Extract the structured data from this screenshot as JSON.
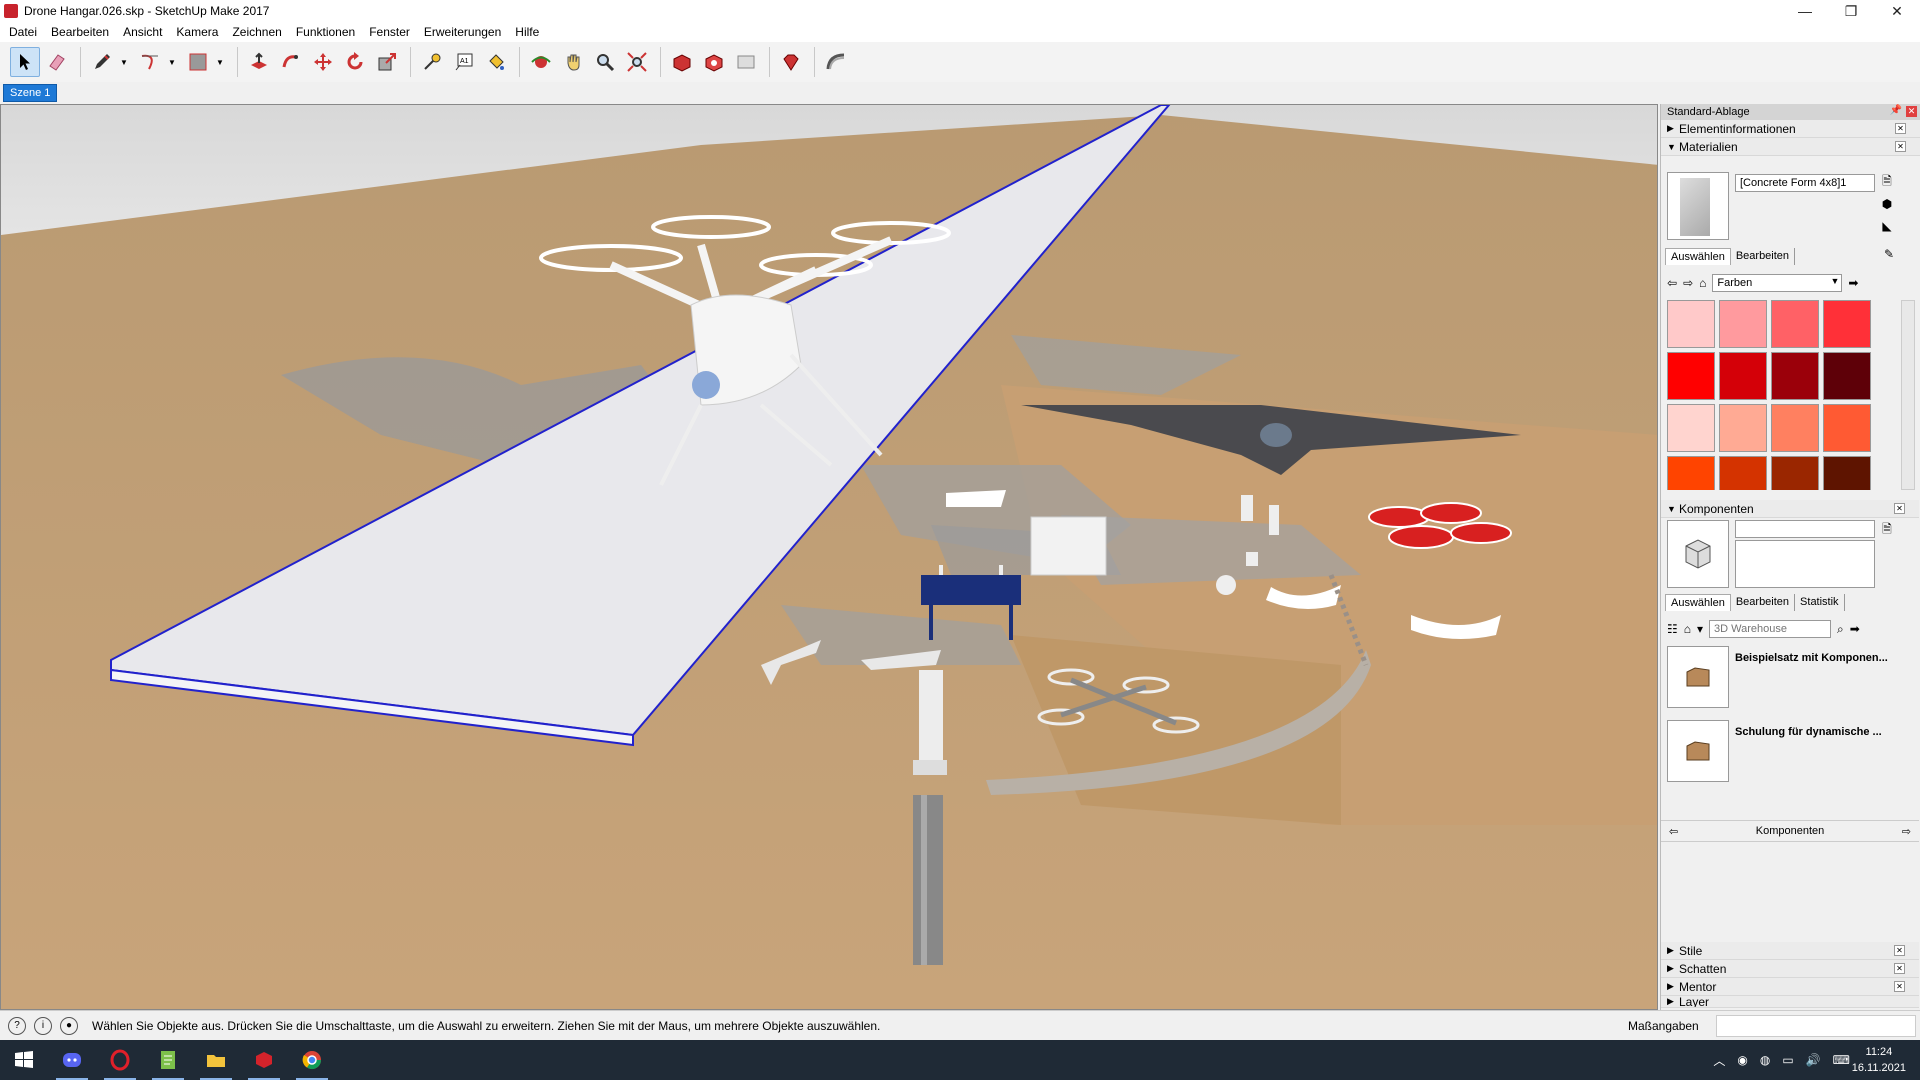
{
  "window": {
    "title": "Drone Hangar.026.skp - SketchUp Make 2017",
    "minimize": "—",
    "maximize": "❐",
    "close": "✕"
  },
  "menu": [
    "Datei",
    "Bearbeiten",
    "Ansicht",
    "Kamera",
    "Zeichnen",
    "Funktionen",
    "Fenster",
    "Erweiterungen",
    "Hilfe"
  ],
  "scene": {
    "tab": "Szene 1"
  },
  "tray": {
    "title": "Standard-Ablage",
    "panels": {
      "entity_info": "Elementinformationen",
      "materials": "Materialien",
      "components": "Komponenten",
      "styles": "Stile",
      "shadows": "Schatten",
      "mentor": "Mentor",
      "layer": "Layer"
    },
    "materials": {
      "current": "[Concrete Form 4x8]1",
      "tab_select": "Auswählen",
      "tab_edit": "Bearbeiten",
      "library": "Farben",
      "swatches": [
        "#ffc9c9",
        "#ff9a9e",
        "#ff6166",
        "#ff3038",
        "#ff0000",
        "#d40008",
        "#9b000a",
        "#5e0008",
        "#ffd4cf",
        "#ffaa94",
        "#ff8060",
        "#ff5a33",
        "#ff4400",
        "#d43300",
        "#9a2600",
        "#5e1400",
        "#ffe4cc",
        "#ffc99a",
        "#ffab60",
        "#ff9a2b",
        "#ff7a00",
        "#d46800",
        "#9a4c00",
        "#5e2e00"
      ]
    },
    "components": {
      "tab_select": "Auswählen",
      "tab_edit": "Bearbeiten",
      "tab_stats": "Statistik",
      "search_placeholder": "3D Warehouse",
      "results": [
        "Beispielsatz mit Komponen...",
        "Schulung für dynamische ..."
      ],
      "footer": "Komponenten"
    }
  },
  "status": {
    "text": "Wählen Sie Objekte aus. Drücken Sie die Umschalttaste, um die Auswahl zu erweitern. Ziehen Sie mit der Maus, um mehrere Objekte auszuwählen.",
    "measure_label": "Maßangaben"
  },
  "taskbar": {
    "time": "11:24",
    "date": "16.11.2021"
  }
}
